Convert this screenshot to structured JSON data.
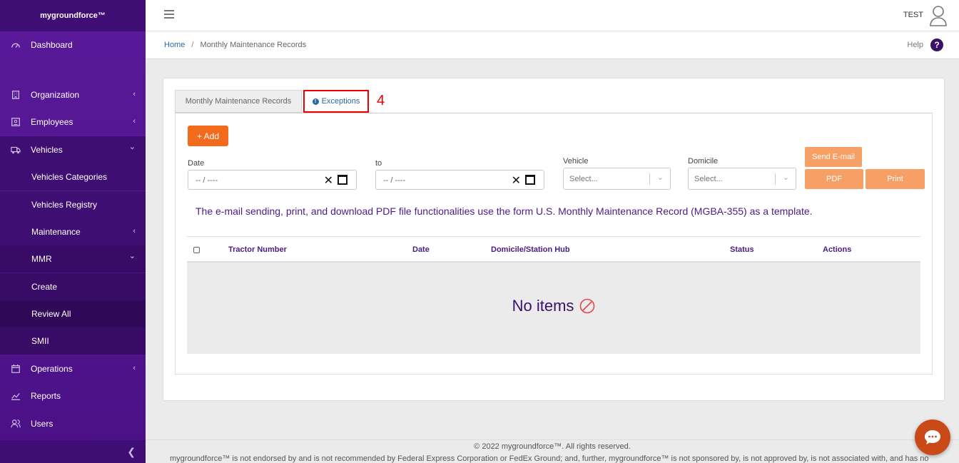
{
  "brand": "mygroundforce™",
  "sidebar": {
    "items": [
      {
        "label": "Dashboard",
        "icon": "gauge-icon"
      },
      {
        "label": "Organization",
        "icon": "building-icon"
      },
      {
        "label": "Employees",
        "icon": "id-card-icon"
      },
      {
        "label": "Vehicles",
        "icon": "truck-icon"
      },
      {
        "label": "Vehicles Categories"
      },
      {
        "label": "Vehicles Registry"
      },
      {
        "label": "Maintenance"
      },
      {
        "label": "MMR"
      },
      {
        "label": "Create"
      },
      {
        "label": "Review All"
      },
      {
        "label": "SMII"
      },
      {
        "label": "Operations",
        "icon": "calendar-icon"
      },
      {
        "label": "Reports",
        "icon": "chart-line-icon"
      },
      {
        "label": "Users",
        "icon": "users-icon"
      }
    ],
    "chevron_left": "‹",
    "chevron_down": "⌄",
    "collapse": "❮"
  },
  "header": {
    "user": "TEST"
  },
  "breadcrumb": {
    "home": "Home",
    "separator": "/",
    "current": "Monthly Maintenance Records"
  },
  "help": {
    "label": "Help",
    "icon_glyph": "?"
  },
  "tabs": {
    "mmr": "Monthly Maintenance Records",
    "exceptions": "Exceptions",
    "exceptions_icon": "!"
  },
  "annotation": "4",
  "filters": {
    "add_label": "+ Add",
    "date_label": "Date",
    "to_label": "to",
    "date_placeholder": "-- / ----",
    "clear_glyph": "✕",
    "vehicle_label": "Vehicle",
    "domicile_label": "Domicile",
    "select_placeholder": "Select...",
    "select_arrow": "⌄",
    "send_email": "Send E-mail",
    "pdf": "PDF",
    "print": "Print"
  },
  "info_text": "The e-mail sending, print, and download PDF file functionalities use the form U.S. Monthly Maintenance Record (MGBA-355) as a template.",
  "table": {
    "columns": [
      "Tractor Number",
      "Date",
      "Domicile/Station Hub",
      "Status",
      "Actions"
    ],
    "empty_message": "No items"
  },
  "footer": {
    "copyright": "© 2022 mygroundforce™. All rights reserved.",
    "disclaimer": "mygroundforce™ is not endorsed by and is not recommended by Federal Express Corporation or FedEx Ground; and, further, mygroundforce™ is not sponsored by, is not approved by, is not associated with, and has no"
  },
  "colors": {
    "sidebar": "#4f138c",
    "accent": "#f26b1d",
    "accent_light": "#f7a065",
    "brand_text": "#4b1b86",
    "annotation": "#e00000"
  }
}
